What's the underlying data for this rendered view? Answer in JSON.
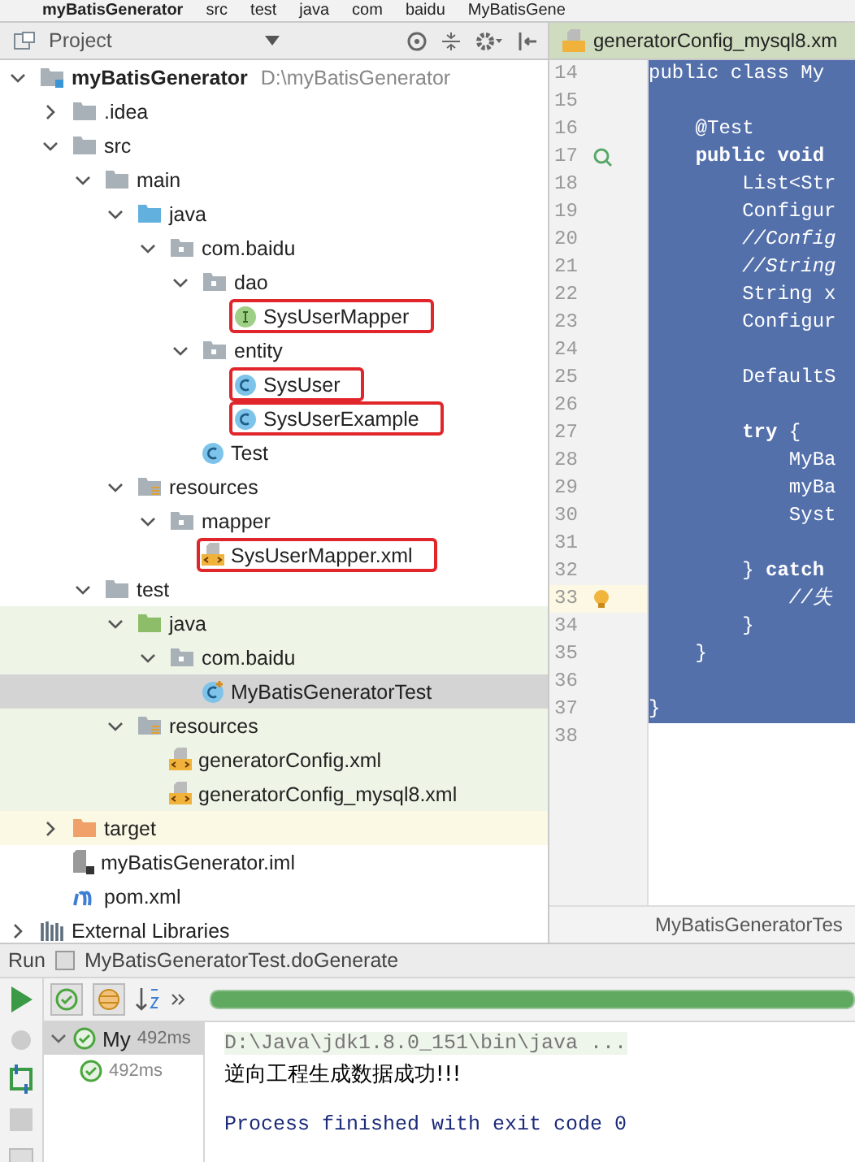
{
  "breadcrumb": [
    {
      "label": "myBatisGenerator",
      "kind": "module"
    },
    {
      "label": "src",
      "kind": "folder"
    },
    {
      "label": "test",
      "kind": "folder"
    },
    {
      "label": "java",
      "kind": "folder"
    },
    {
      "label": "com",
      "kind": "folder"
    },
    {
      "label": "baidu",
      "kind": "folder"
    },
    {
      "label": "MyBatisGene",
      "kind": "class"
    }
  ],
  "project_panel": {
    "title": "Project",
    "tree": [
      {
        "label": "myBatisGenerator",
        "path": "D:\\myBatisGenerator",
        "kind": "module",
        "expanded": true,
        "selected": false,
        "children": [
          {
            "label": ".idea",
            "kind": "folder",
            "expanded": false,
            "selected": false
          },
          {
            "label": "src",
            "kind": "folder",
            "expanded": true,
            "selected": false,
            "children": [
              {
                "label": "main",
                "kind": "folder",
                "expanded": true,
                "selected": false,
                "children": [
                  {
                    "label": "java",
                    "kind": "source-folder",
                    "expanded": true,
                    "selected": false,
                    "children": [
                      {
                        "label": "com.baidu",
                        "kind": "package",
                        "expanded": true,
                        "selected": false,
                        "children": [
                          {
                            "label": "dao",
                            "kind": "package",
                            "expanded": true,
                            "selected": false,
                            "children": [
                              {
                                "label": "SysUserMapper",
                                "kind": "interface",
                                "selected": false,
                                "boxed": true
                              }
                            ]
                          },
                          {
                            "label": "entity",
                            "kind": "package",
                            "expanded": true,
                            "selected": false,
                            "children": [
                              {
                                "label": "SysUser",
                                "kind": "class",
                                "selected": false,
                                "boxed": true
                              },
                              {
                                "label": "SysUserExample",
                                "kind": "class",
                                "selected": false,
                                "boxed": true
                              }
                            ]
                          },
                          {
                            "label": "Test",
                            "kind": "class",
                            "selected": false
                          }
                        ]
                      }
                    ]
                  },
                  {
                    "label": "resources",
                    "kind": "resources-folder",
                    "expanded": true,
                    "selected": false,
                    "children": [
                      {
                        "label": "mapper",
                        "kind": "package",
                        "expanded": true,
                        "selected": false,
                        "children": [
                          {
                            "label": "SysUserMapper.xml",
                            "kind": "xml",
                            "selected": false,
                            "boxed": true
                          }
                        ]
                      }
                    ]
                  }
                ]
              },
              {
                "label": "test",
                "kind": "folder",
                "expanded": true,
                "selected": false,
                "children": [
                  {
                    "label": "java",
                    "kind": "test-folder",
                    "test": true,
                    "expanded": true,
                    "selected": false,
                    "children": [
                      {
                        "label": "com.baidu",
                        "kind": "package",
                        "test": true,
                        "expanded": true,
                        "selected": false,
                        "children": [
                          {
                            "label": "MyBatisGeneratorTest",
                            "kind": "test-class",
                            "test": true,
                            "selected": true
                          }
                        ]
                      }
                    ]
                  },
                  {
                    "label": "resources",
                    "kind": "test-resources-folder",
                    "test": true,
                    "expanded": true,
                    "selected": false,
                    "children": [
                      {
                        "label": "generatorConfig.xml",
                        "kind": "xml",
                        "test": true,
                        "selected": false
                      },
                      {
                        "label": "generatorConfig_mysql8.xml",
                        "kind": "xml",
                        "test": true,
                        "selected": false
                      }
                    ]
                  }
                ]
              }
            ]
          },
          {
            "label": "target",
            "kind": "excluded-folder",
            "excluded": true,
            "expanded": false,
            "selected": false
          },
          {
            "label": "myBatisGenerator.iml",
            "kind": "iml",
            "selected": false
          },
          {
            "label": "pom.xml",
            "kind": "maven",
            "selected": false
          }
        ]
      },
      {
        "label": "External Libraries",
        "kind": "libraries",
        "expanded": false,
        "selected": false
      }
    ]
  },
  "editor": {
    "tab": "generatorConfig_mysql8.xm",
    "lines": [
      {
        "number": "14",
        "text": "public class My",
        "kind": "code",
        "selected": true
      },
      {
        "number": "15",
        "selected": true
      },
      {
        "number": "16",
        "text": "    @Test",
        "kind": "code",
        "selected": true
      },
      {
        "number": "17",
        "text": "    **public** **void**",
        "kind": "code",
        "selected": true,
        "run_marker": true
      },
      {
        "number": "18",
        "text": "        List<Str",
        "kind": "code",
        "selected": true
      },
      {
        "number": "19",
        "text": "        Configur",
        "kind": "code",
        "selected": true
      },
      {
        "number": "20",
        "text": "        //Config",
        "kind": "comment",
        "selected": true
      },
      {
        "number": "21",
        "text": "        //String",
        "kind": "comment",
        "selected": true
      },
      {
        "number": "22",
        "text": "        String x",
        "kind": "code",
        "selected": true
      },
      {
        "number": "23",
        "text": "        Configur",
        "kind": "code",
        "selected": true
      },
      {
        "number": "24",
        "selected": true
      },
      {
        "number": "25",
        "text": "        DefaultS",
        "kind": "code",
        "selected": true
      },
      {
        "number": "26",
        "selected": true
      },
      {
        "number": "27",
        "text": "        **try** {",
        "kind": "code",
        "selected": true
      },
      {
        "number": "28",
        "text": "            MyBa",
        "kind": "code",
        "selected": true
      },
      {
        "number": "29",
        "text": "            myBa",
        "kind": "code",
        "selected": true
      },
      {
        "number": "30",
        "text": "            Syst",
        "kind": "code",
        "selected": true
      },
      {
        "number": "31",
        "selected": true
      },
      {
        "number": "32",
        "text": "        } **catch**",
        "kind": "code",
        "selected": true
      },
      {
        "number": "33",
        "text": "            //失",
        "kind": "comment",
        "selected": true,
        "current": true,
        "bulb": true
      },
      {
        "number": "34",
        "text": "        }",
        "kind": "code",
        "selected": true
      },
      {
        "number": "35",
        "text": "    }",
        "kind": "code",
        "selected": true
      },
      {
        "number": "36",
        "selected": true
      },
      {
        "number": "37",
        "text": "}",
        "kind": "code",
        "selected": true
      },
      {
        "number": "38",
        "selected": false
      }
    ],
    "footer": "MyBatisGeneratorTes"
  },
  "run_panel": {
    "label": "Run",
    "config": "MyBatisGeneratorTest.doGenerate",
    "progress": {
      "level": 1
    },
    "tests": [
      {
        "name": "My",
        "time": "492ms",
        "passed": true,
        "selected": true,
        "children": [
          {
            "time": "492ms",
            "passed": true,
            "selected": false
          }
        ]
      }
    ],
    "console": [
      {
        "text": "D:\\Java\\jdk1.8.0_151\\bin\\java ...",
        "kind": "command"
      },
      {
        "text": "逆向工程生成数据成功!!!",
        "kind": "output"
      },
      {
        "text": "Process finished with exit code 0",
        "kind": "system"
      }
    ]
  }
}
